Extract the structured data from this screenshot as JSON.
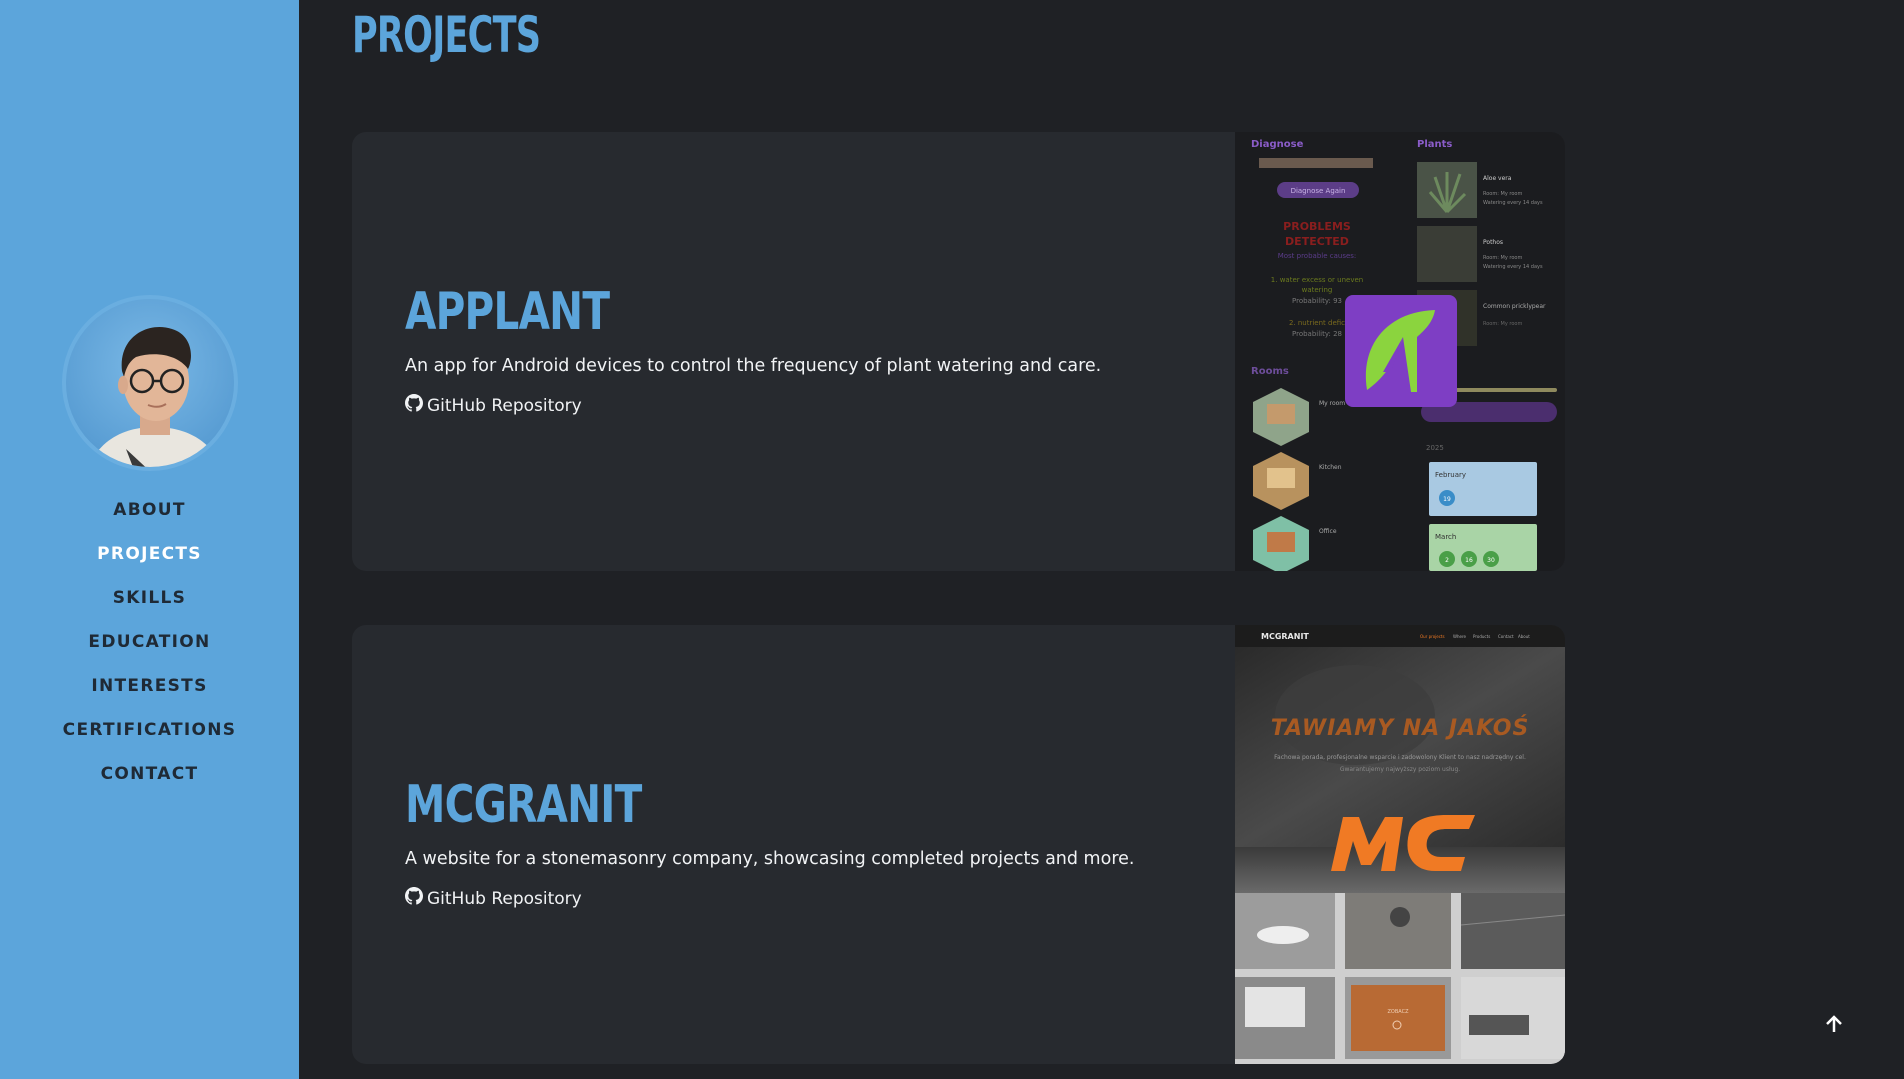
{
  "sidebar": {
    "nav": [
      {
        "label": "ABOUT",
        "active": false
      },
      {
        "label": "PROJECTS",
        "active": true
      },
      {
        "label": "SKILLS",
        "active": false
      },
      {
        "label": "EDUCATION",
        "active": false
      },
      {
        "label": "INTERESTS",
        "active": false
      },
      {
        "label": "CERTIFICATIONS",
        "active": false
      },
      {
        "label": "CONTACT",
        "active": false
      }
    ]
  },
  "main": {
    "title": "PROJECTS",
    "projects": [
      {
        "title": "APPLANT",
        "description": "An app for Android devices to control the frequency of plant watering and care.",
        "link_label": "GitHub Repository",
        "screenshot": {
          "diagnose_heading": "Diagnose",
          "plants_heading": "Plants",
          "diagnose_button": "Diagnose Again",
          "problems_line1": "PROBLEMS",
          "problems_line2": "DETECTED",
          "most_probable": "Most probable causes:",
          "cause1_line1": "1. water excess or uneven",
          "cause1_line2": "watering",
          "cause1_prob": "Probability: 93",
          "cause2_line1": "2. nutrient defic",
          "cause2_prob": "Probability: 28",
          "rooms_heading": "Rooms",
          "plants": [
            {
              "name": "Aloe vera",
              "room": "Room: My room",
              "watering": "Watering every 14 days"
            },
            {
              "name": "Pothos",
              "room": "Room: My room",
              "watering": "Watering every 14 days"
            },
            {
              "name": "Common pricklypear",
              "room": "Room: My room",
              "watering": ""
            }
          ],
          "rooms": [
            "My room",
            "Kitchen",
            "Office"
          ],
          "calendar_year": "2025",
          "months": [
            {
              "name": "February",
              "days": [
                "19"
              ]
            },
            {
              "name": "March",
              "days": [
                "2",
                "16",
                "30"
              ]
            }
          ]
        }
      },
      {
        "title": "MCGRANIT",
        "description": "A website for a stonemasonry company, showcasing completed projects and more.",
        "link_label": "GitHub Repository",
        "screenshot": {
          "logo_text": "MCGRANIT",
          "nav_items": [
            "Our projects",
            "Where",
            "Products",
            "Contact",
            "About"
          ],
          "hero_text": "TAWIAMY NA JAKOŚ",
          "hero_sub1": "Fachowa porada, profesjonalne wsparcie i zadowolony Klient to nasz nadrzędny cel.",
          "hero_sub2": "Gwarantujemy najwyższy poziom usług.",
          "overlay_logo": "MC",
          "gallery_button": "ZOBACZ"
        }
      }
    ]
  },
  "colors": {
    "accent": "#5ca5db",
    "background": "#1f2125",
    "card": "#272a2f",
    "applant_purple": "#7e3ec4",
    "applant_green": "#8bd43e",
    "mcgranit_orange": "#f07a24"
  }
}
